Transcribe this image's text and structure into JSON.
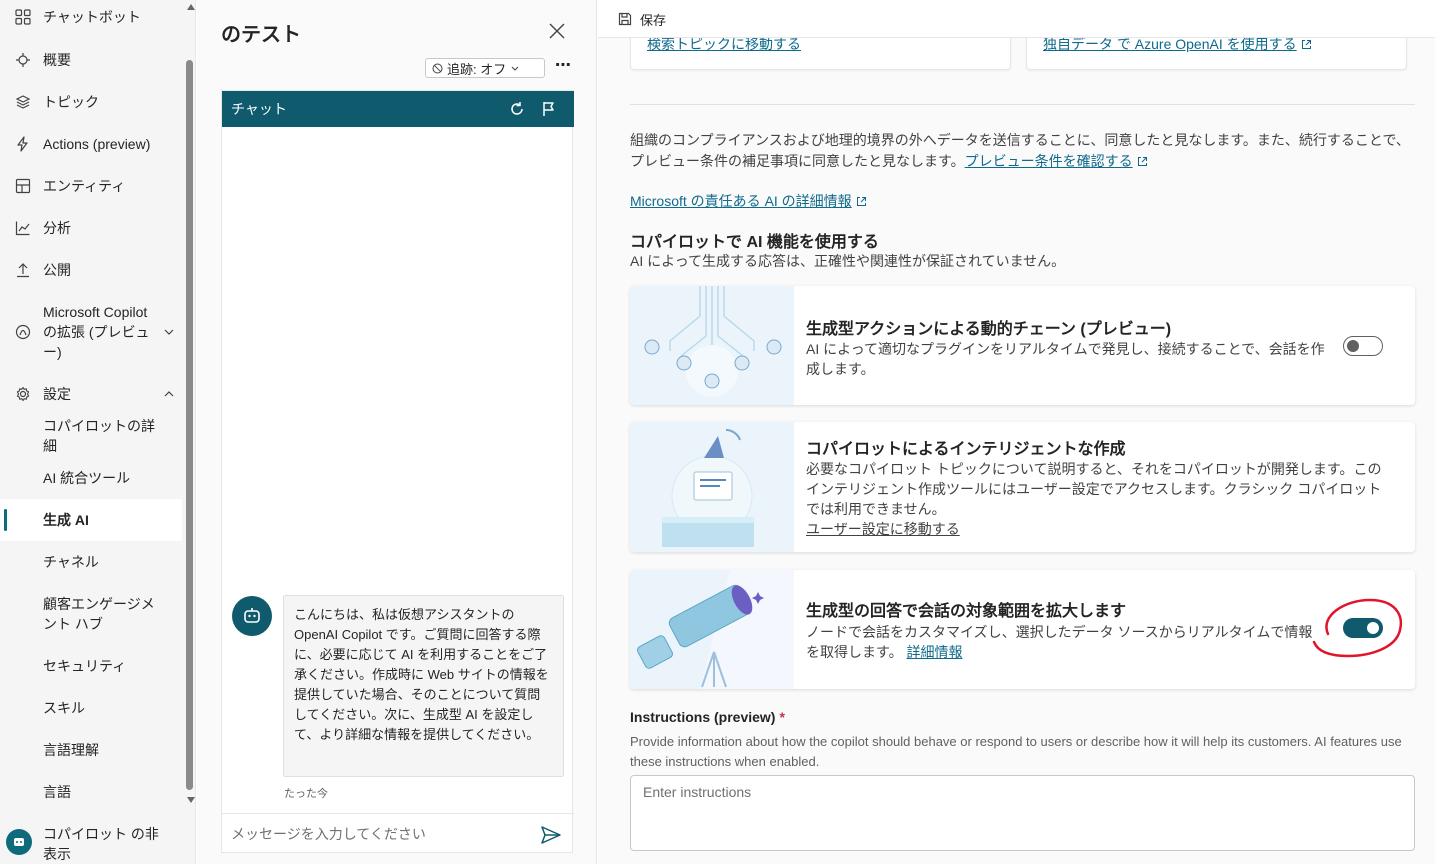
{
  "sidebar": {
    "items": [
      {
        "label": "チャットボット",
        "icon": "grid-icon"
      },
      {
        "label": "概要",
        "icon": "overview-icon"
      },
      {
        "label": "トピック",
        "icon": "topics-icon"
      },
      {
        "label": "Actions (preview)",
        "icon": "lightning-icon"
      },
      {
        "label": "エンティティ",
        "icon": "entities-icon"
      },
      {
        "label": "分析",
        "icon": "analytics-icon"
      },
      {
        "label": "公開",
        "icon": "publish-icon"
      },
      {
        "label": "Microsoft Copilot の拡張 (プレビュー)",
        "icon": "copilot-icon"
      },
      {
        "label": "設定",
        "icon": "gear-icon"
      }
    ],
    "settings_items": [
      {
        "label": "コパイロットの詳細"
      },
      {
        "label": "AI 統合ツール"
      },
      {
        "label": "生成 AI"
      },
      {
        "label": "チャネル"
      },
      {
        "label": "顧客エンゲージメント ハブ"
      },
      {
        "label": "セキュリティ"
      },
      {
        "label": "スキル"
      },
      {
        "label": "言語理解"
      },
      {
        "label": "言語"
      }
    ],
    "bottom_label": "コパイロット の非表示"
  },
  "test_panel": {
    "title": "のテスト",
    "tracking_label": "追跡: オフ",
    "chat_title": "チャット",
    "bot_message": "こんにちは、私は仮想アシスタントの OpenAI Copilot です。ご質問に回答する際に、必要に応じて AI を利用することをご了承ください。作成時に Web サイトの情報を提供していた場合、そのことについて質問してください。次に、生成型 AI を設定して、より詳細な情報を提供してください。",
    "message_time": "たった今",
    "input_placeholder": "メッセージを入力してください"
  },
  "main": {
    "save_label": "保存",
    "top_links": [
      {
        "label": "検索トピックに移動する"
      },
      {
        "label": "独自データ で Azure OpenAI を使用する"
      }
    ],
    "consent_text": "組織のコンプライアンスおよび地理的境界の外へデータを送信することに、同意したと見なします。また、続行することで、プレビュー条件の補足事項に同意したと見なします。",
    "preview_terms_link": "プレビュー条件を確認する",
    "responsible_ai_link": "Microsoft の責任ある AI の詳細情報",
    "section_title": "コパイロットで AI 機能を使用する",
    "section_subtitle": "AI によって生成する応答は、正確性や関連性が保証されていません。",
    "features": [
      {
        "title": "生成型アクションによる動的チェーン (プレビュー)",
        "description": "AI によって適切なプラグインをリアルタイムで発見し、接続することで、会話を作成します。",
        "enabled": false
      },
      {
        "title": "コパイロットによるインテリジェントな作成",
        "description": "必要なコパイロット トピックについて説明すると、それをコパイロットが開発します。このインテリジェント作成ツールにはユーザー設定でアクセスします。クラシック コパイロットでは利用できません。",
        "link": "ユーザー設定に移動する"
      },
      {
        "title": "生成型の回答で会話の対象範囲を拡大します",
        "description": "ノードで会話をカスタマイズし、選択したデータ ソースからリアルタイムで情報を取得します。",
        "link": "詳細情報",
        "enabled": true
      }
    ],
    "instructions_label": "Instructions (preview)",
    "instructions_required": "*",
    "instructions_help": "Provide information about how the copilot should behave or respond to users or describe how it will help its customers. AI features use these instructions when enabled.",
    "instructions_placeholder": "Enter instructions"
  },
  "colors": {
    "accent": "#0f5a6c",
    "link": "#0f6a8c",
    "annotation": "#e0142b"
  }
}
